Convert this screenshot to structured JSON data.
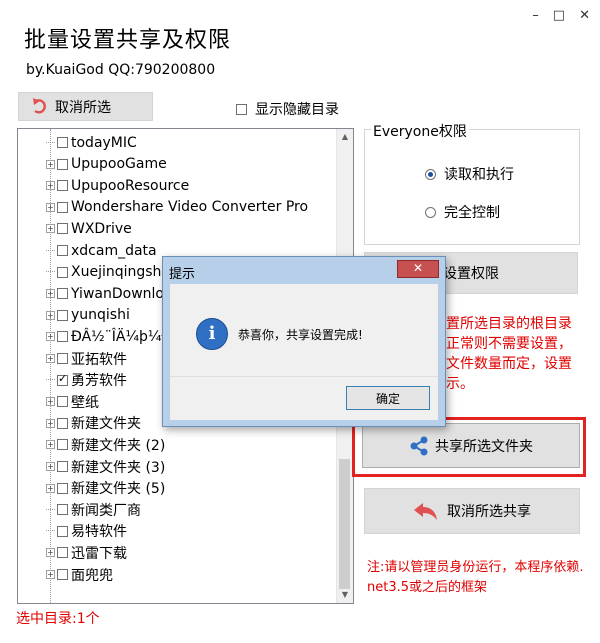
{
  "window": {
    "minimize": "–",
    "maximize": "□",
    "close": "✕"
  },
  "title": "批量设置共享及权限",
  "subtitle": "by.KuaiGod  QQ:790200800",
  "toolbar": {
    "cancel_select_label": "取消所选",
    "show_hidden_label": "显示隐藏目录",
    "show_hidden_checked": false
  },
  "tree": {
    "items": [
      {
        "label": "todayMIC",
        "expandable": false,
        "checked": false
      },
      {
        "label": "UpupooGame",
        "expandable": true,
        "checked": false
      },
      {
        "label": "UpupooResource",
        "expandable": true,
        "checked": false
      },
      {
        "label": "Wondershare Video Converter Pro",
        "expandable": true,
        "checked": false
      },
      {
        "label": "WXDrive",
        "expandable": true,
        "checked": false
      },
      {
        "label": "xdcam_data",
        "expandable": false,
        "checked": false
      },
      {
        "label": "Xuejinqingsh",
        "expandable": false,
        "checked": false
      },
      {
        "label": "YiwanDownlo",
        "expandable": true,
        "checked": false
      },
      {
        "label": "yunqishi",
        "expandable": true,
        "checked": false
      },
      {
        "label": "ĐÂ½¨ÎÄ¼þ¼Ð",
        "expandable": true,
        "checked": false
      },
      {
        "label": "亚拓软件",
        "expandable": true,
        "checked": false
      },
      {
        "label": "勇芳软件",
        "expandable": false,
        "checked": true
      },
      {
        "label": "壁纸",
        "expandable": true,
        "checked": false
      },
      {
        "label": "新建文件夹",
        "expandable": true,
        "checked": false
      },
      {
        "label": "新建文件夹 (2)",
        "expandable": true,
        "checked": false
      },
      {
        "label": "新建文件夹 (3)",
        "expandable": true,
        "checked": false
      },
      {
        "label": "新建文件夹 (5)",
        "expandable": true,
        "checked": false
      },
      {
        "label": "新闻类厂商",
        "expandable": false,
        "checked": false
      },
      {
        "label": "易特软件",
        "expandable": false,
        "checked": false
      },
      {
        "label": "迅雷下载",
        "expandable": true,
        "checked": false
      },
      {
        "label": "面兜兜",
        "expandable": true,
        "checked": false
      }
    ]
  },
  "permissions": {
    "legend": "Everyone权限",
    "options": [
      {
        "label": "读取和执行",
        "selected": true
      },
      {
        "label": "完全控制",
        "selected": false
      }
    ],
    "set_button": "设置权限"
  },
  "note_partial": [
    "置所选目录的根目录",
    "正常则不需要设置，",
    "文件数量而定，设置",
    "示。"
  ],
  "share_button": "共享所选文件夹",
  "unshare_button": "取消所选共享",
  "footer_note": [
    "注:请以管理员身份运行，本程序依赖.",
    "net3.5或之后的框架"
  ],
  "status": "选中目录:1个",
  "dialog": {
    "title": "提示",
    "close": "✕",
    "message": "恭喜你，共享设置完成!",
    "ok_label": "确定"
  },
  "colors": {
    "red_text": "#e00000",
    "share_icon": "#2f6fc4",
    "undo_arrow": "#e05050"
  }
}
